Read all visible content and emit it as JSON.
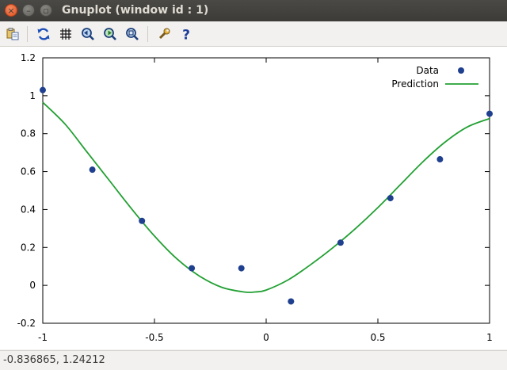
{
  "window": {
    "title": "Gnuplot (window id : 1)",
    "close_glyph": "×",
    "min_glyph": "–",
    "max_glyph": "▫"
  },
  "toolbar": {
    "items": [
      {
        "icon": "copy-clipboard-icon"
      },
      {
        "icon": "replot-icon"
      },
      {
        "icon": "grid-icon"
      },
      {
        "icon": "zoom-previous-icon"
      },
      {
        "icon": "zoom-next-icon"
      },
      {
        "icon": "autoscale-icon"
      },
      {
        "icon": "config-wrench-icon"
      },
      {
        "icon": "help-icon"
      }
    ]
  },
  "status": {
    "coords": "-0.836865,  1.24212"
  },
  "chart_data": {
    "type": "scatter",
    "title": "",
    "xlabel": "",
    "ylabel": "",
    "xlim": [
      -1,
      1
    ],
    "ylim": [
      -0.2,
      1.2
    ],
    "x_ticks": [
      -1,
      -0.5,
      0,
      0.5,
      1
    ],
    "x_tick_labels": [
      "-1",
      "-0.5",
      "0",
      "0.5",
      "1"
    ],
    "y_ticks": [
      -0.2,
      0,
      0.2,
      0.4,
      0.6,
      0.8,
      1,
      1.2
    ],
    "y_tick_labels": [
      "-0.2",
      "0",
      "0.2",
      "0.4",
      "0.6",
      "0.8",
      "1",
      "1.2"
    ],
    "grid": false,
    "legend_position": "top-right",
    "series": [
      {
        "name": "Data",
        "kind": "points",
        "color": "#1f3f8f",
        "x": [
          -1.0,
          -0.778,
          -0.556,
          -0.333,
          -0.111,
          0.111,
          0.333,
          0.556,
          0.778,
          1.0
        ],
        "y": [
          1.03,
          0.61,
          0.34,
          0.09,
          0.09,
          -0.085,
          0.225,
          0.46,
          0.665,
          0.905
        ]
      },
      {
        "name": "Prediction",
        "kind": "line",
        "color": "#22a033",
        "x": [
          -1.0,
          -0.9,
          -0.8,
          -0.7,
          -0.6,
          -0.5,
          -0.4,
          -0.3,
          -0.2,
          -0.1,
          -0.05,
          0.0,
          0.1,
          0.2,
          0.3,
          0.4,
          0.5,
          0.6,
          0.7,
          0.8,
          0.9,
          1.0
        ],
        "y": [
          0.965,
          0.85,
          0.7,
          0.55,
          0.4,
          0.26,
          0.14,
          0.05,
          -0.01,
          -0.035,
          -0.035,
          -0.025,
          0.03,
          0.11,
          0.2,
          0.3,
          0.41,
          0.53,
          0.65,
          0.755,
          0.835,
          0.88
        ]
      }
    ]
  }
}
